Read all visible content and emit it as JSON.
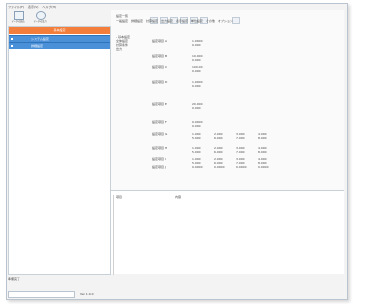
{
  "menu": [
    "ファイル(F)",
    "表示(V)",
    "ヘルプ(H)"
  ],
  "toolbar": [
    {
      "label": "データの読込",
      "icon": "document-icon"
    },
    {
      "label": "データの出力",
      "icon": "search-icon"
    }
  ],
  "left_panel": {
    "header": "基本設定",
    "items": [
      "システム設定",
      "詳細設定"
    ]
  },
  "main": {
    "title": "設定一覧",
    "tabs": [
      "一般設定",
      "詳細設定",
      "計算設定",
      "出力設定",
      "表示設定",
      "単位設定",
      "その他",
      "オプション"
    ],
    "tree": [
      "- 基本設定",
      "  全体設定",
      "  計算条件",
      "  出力"
    ],
    "rows": [
      {
        "label": "設定項目 A",
        "values": [
          "1.0000",
          "0.000"
        ]
      },
      {
        "label": "設定項目 B",
        "values": [
          "10.000",
          "0.000"
        ]
      },
      {
        "label": "設定項目 C",
        "values": [
          "100.00",
          "0.000"
        ]
      },
      {
        "label": "設定項目 D",
        "values": [
          "1.0000",
          "0.000"
        ]
      },
      {
        "label": "設定項目 E",
        "values": [
          "20.000",
          "0.000"
        ]
      },
      {
        "label": "設定項目 F",
        "values": [
          "0.0000",
          "0.000"
        ]
      },
      {
        "label": "設定項目 G",
        "values": [
          "1.000",
          "2.000",
          "3.000",
          "4.000",
          "5.000",
          "6.000",
          "7.000",
          "8.000"
        ]
      },
      {
        "label": "設定項目 H",
        "values": [
          "1.000",
          "2.000",
          "3.000",
          "4.000",
          "5.000",
          "6.000",
          "7.000",
          "8.000"
        ]
      },
      {
        "label": "設定項目 I",
        "values": [
          "1.000",
          "2.000",
          "3.000",
          "4.000",
          "5.000",
          "6.000",
          "7.000",
          "8.000"
        ]
      },
      {
        "label": "設定項目 J",
        "values": [
          "0.0000",
          "0.0000",
          "0.0000",
          "0.0000"
        ]
      }
    ]
  },
  "lower": {
    "col1": "項目",
    "col2": "内容"
  },
  "status": "準備完了",
  "bottom": "Ver 1.0.0"
}
